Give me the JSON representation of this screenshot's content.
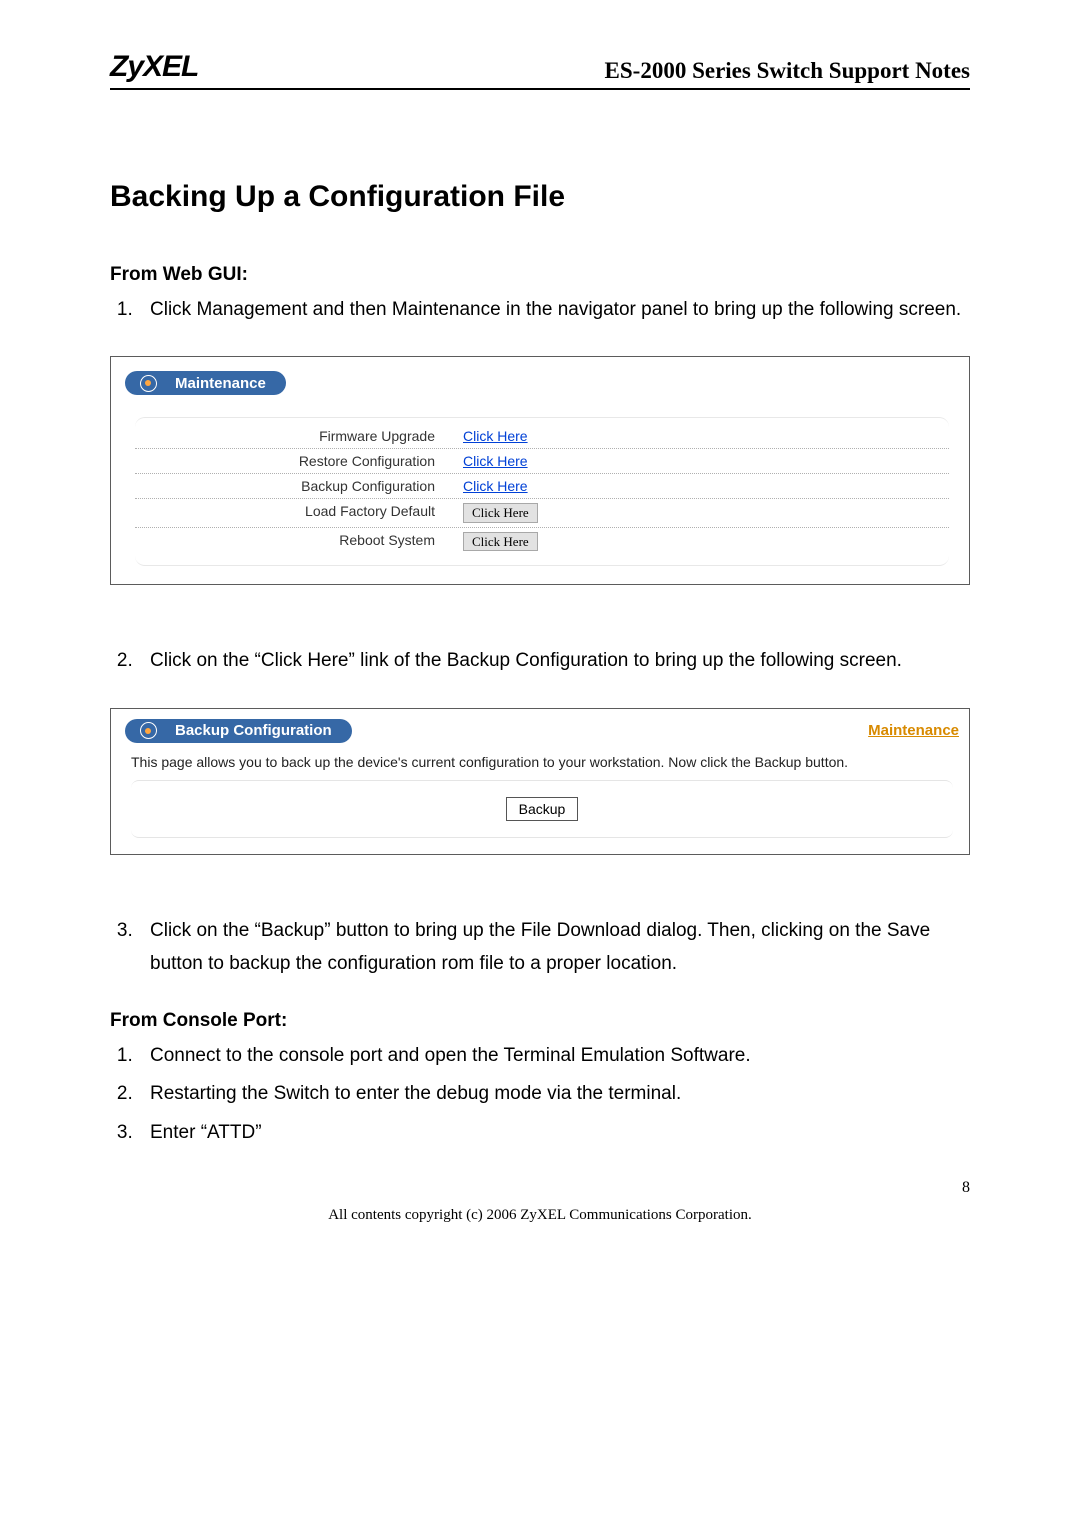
{
  "header": {
    "logo": "ZyXEL",
    "doc_title": "ES-2000 Series Switch Support Notes"
  },
  "section_title": "Backing Up a Configuration File",
  "web_gui": {
    "heading": "From Web GUI:",
    "steps": [
      "Click Management and then Maintenance in the navigator panel to bring up the following screen.",
      "Click on the “Click Here” link of the Backup Configuration to bring up the following screen.",
      "Click on the “Backup” button to bring up the File Download dialog. Then, clicking on the Save button to backup the configuration rom file to a proper location."
    ]
  },
  "screenshot1": {
    "panel_title": "Maintenance",
    "rows": [
      {
        "label": "Firmware Upgrade",
        "action": "Click Here",
        "style": "link"
      },
      {
        "label": "Restore Configuration",
        "action": "Click Here",
        "style": "link"
      },
      {
        "label": "Backup Configuration",
        "action": "Click Here",
        "style": "link"
      },
      {
        "label": "Load Factory Default",
        "action": "Click Here",
        "style": "button"
      },
      {
        "label": "Reboot System",
        "action": "Click Here",
        "style": "button"
      }
    ]
  },
  "screenshot2": {
    "panel_title": "Backup Configuration",
    "breadcrumb": "Maintenance",
    "desc": "This page allows you to back up the device's current configuration to your workstation. Now click the Backup button.",
    "button": "Backup"
  },
  "console": {
    "heading": "From Console Port:",
    "steps": [
      "Connect to the console port and open the Terminal Emulation Software.",
      "Restarting the Switch to enter the debug mode via the terminal.",
      "Enter “ATTD”"
    ]
  },
  "page_number": "8",
  "footer": "All contents copyright (c) 2006 ZyXEL Communications Corporation."
}
